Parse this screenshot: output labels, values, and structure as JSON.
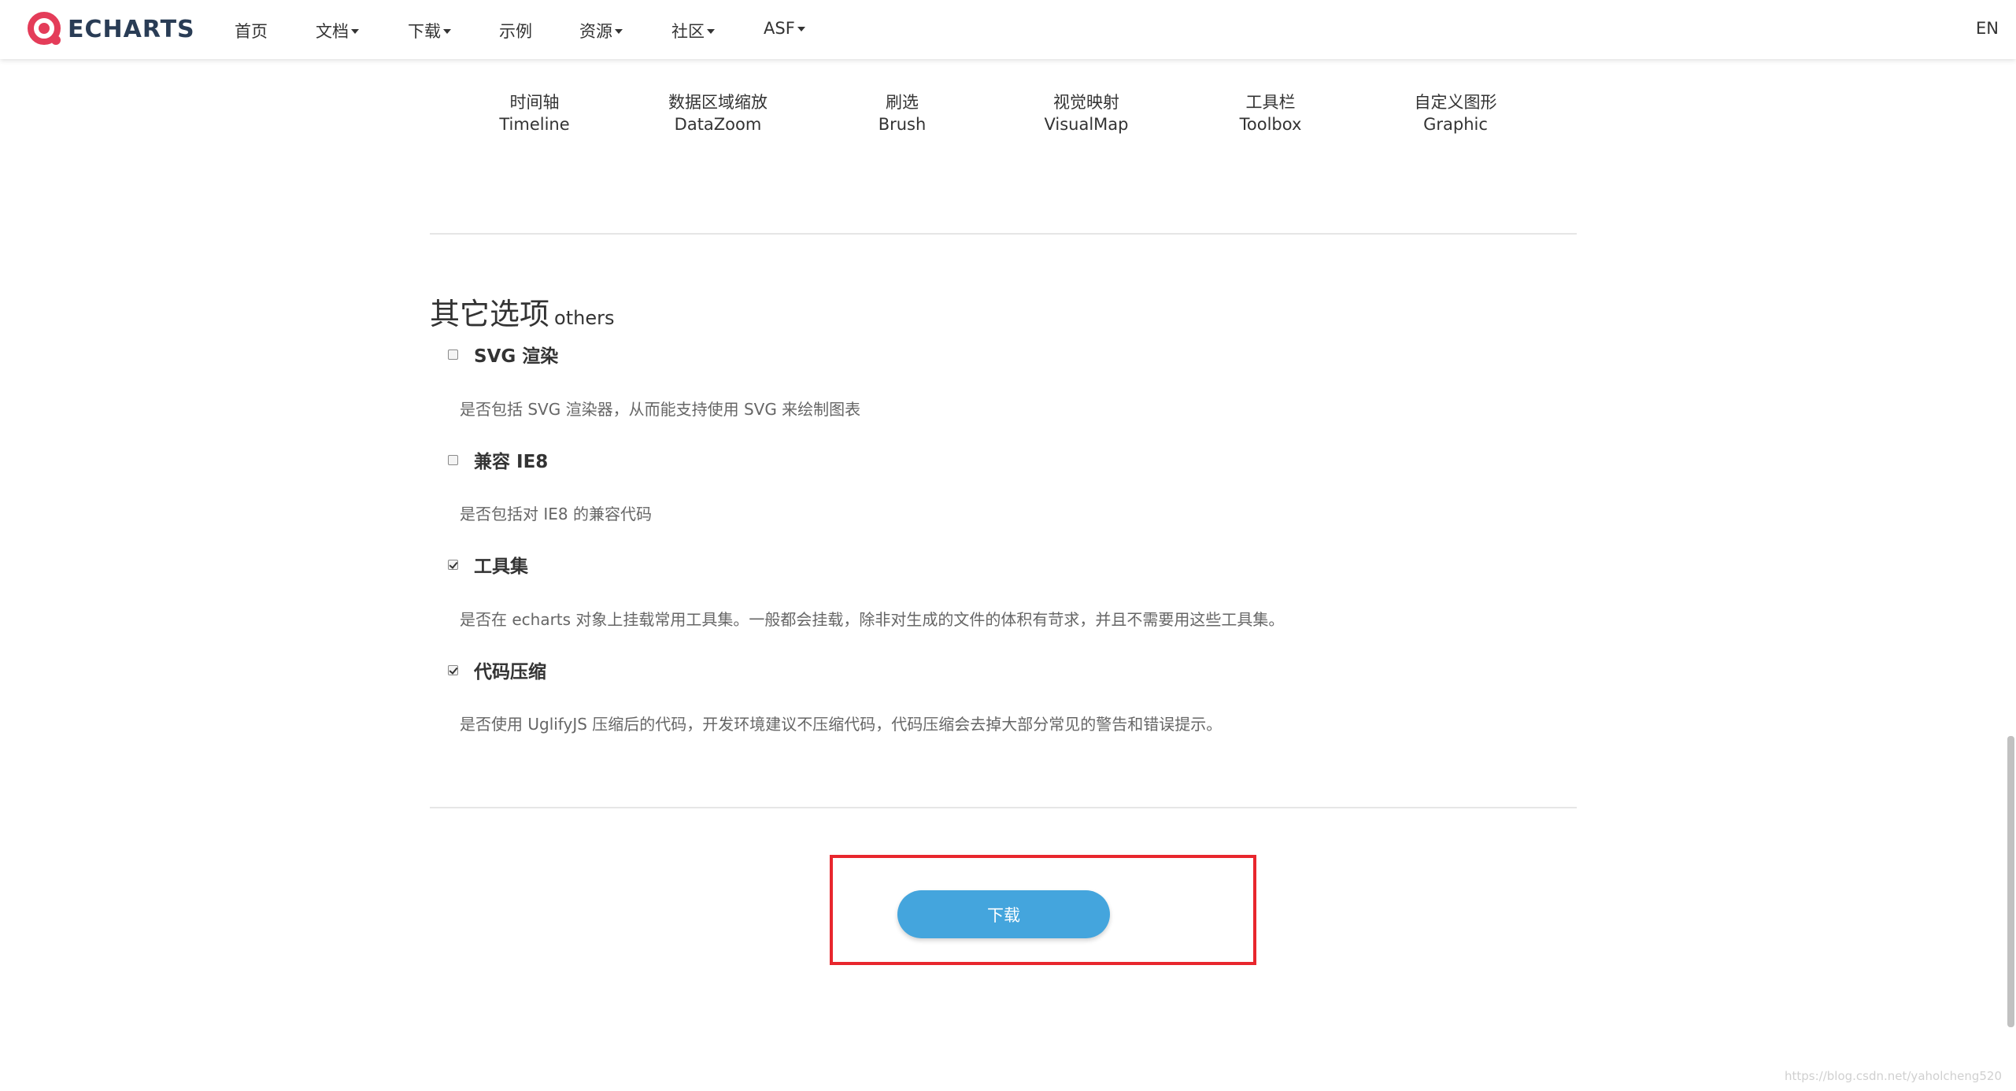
{
  "nav": {
    "logo_text": "ECHARTS",
    "items": [
      {
        "label": "首页",
        "dropdown": false
      },
      {
        "label": "文档",
        "dropdown": true
      },
      {
        "label": "下载",
        "dropdown": true
      },
      {
        "label": "示例",
        "dropdown": false
      },
      {
        "label": "资源",
        "dropdown": true
      },
      {
        "label": "社区",
        "dropdown": true
      },
      {
        "label": "ASF",
        "dropdown": true
      }
    ],
    "lang": "EN"
  },
  "components": [
    {
      "zh": "时间轴",
      "en": "Timeline"
    },
    {
      "zh": "数据区域缩放",
      "en": "DataZoom"
    },
    {
      "zh": "刷选",
      "en": "Brush"
    },
    {
      "zh": "视觉映射",
      "en": "VisualMap"
    },
    {
      "zh": "工具栏",
      "en": "Toolbox"
    },
    {
      "zh": "自定义图形",
      "en": "Graphic"
    }
  ],
  "others": {
    "title_zh": "其它选项",
    "title_en": "others",
    "options": [
      {
        "label": "SVG 渲染",
        "checked": false,
        "desc": "是否包括 SVG 渲染器，从而能支持使用 SVG 来绘制图表"
      },
      {
        "label": "兼容 IE8",
        "checked": false,
        "desc": "是否包括对 IE8 的兼容代码"
      },
      {
        "label": "工具集",
        "checked": true,
        "desc": "是否在 echarts 对象上挂载常用工具集。一般都会挂载，除非对生成的文件的体积有苛求，并且不需要用这些工具集。"
      },
      {
        "label": "代码压缩",
        "checked": true,
        "desc": "是否使用 UglifyJS 压缩后的代码，开发环境建议不压缩代码，代码压缩会去掉大部分常见的警告和错误提示。"
      }
    ]
  },
  "download": {
    "label": "下载"
  },
  "watermark": "https://blog.csdn.net/yaholcheng520",
  "colors": {
    "brand_red": "#e43c59",
    "logo_text": "#293c55",
    "download_button": "#44a5dd",
    "highlight_border": "#e8262d"
  }
}
